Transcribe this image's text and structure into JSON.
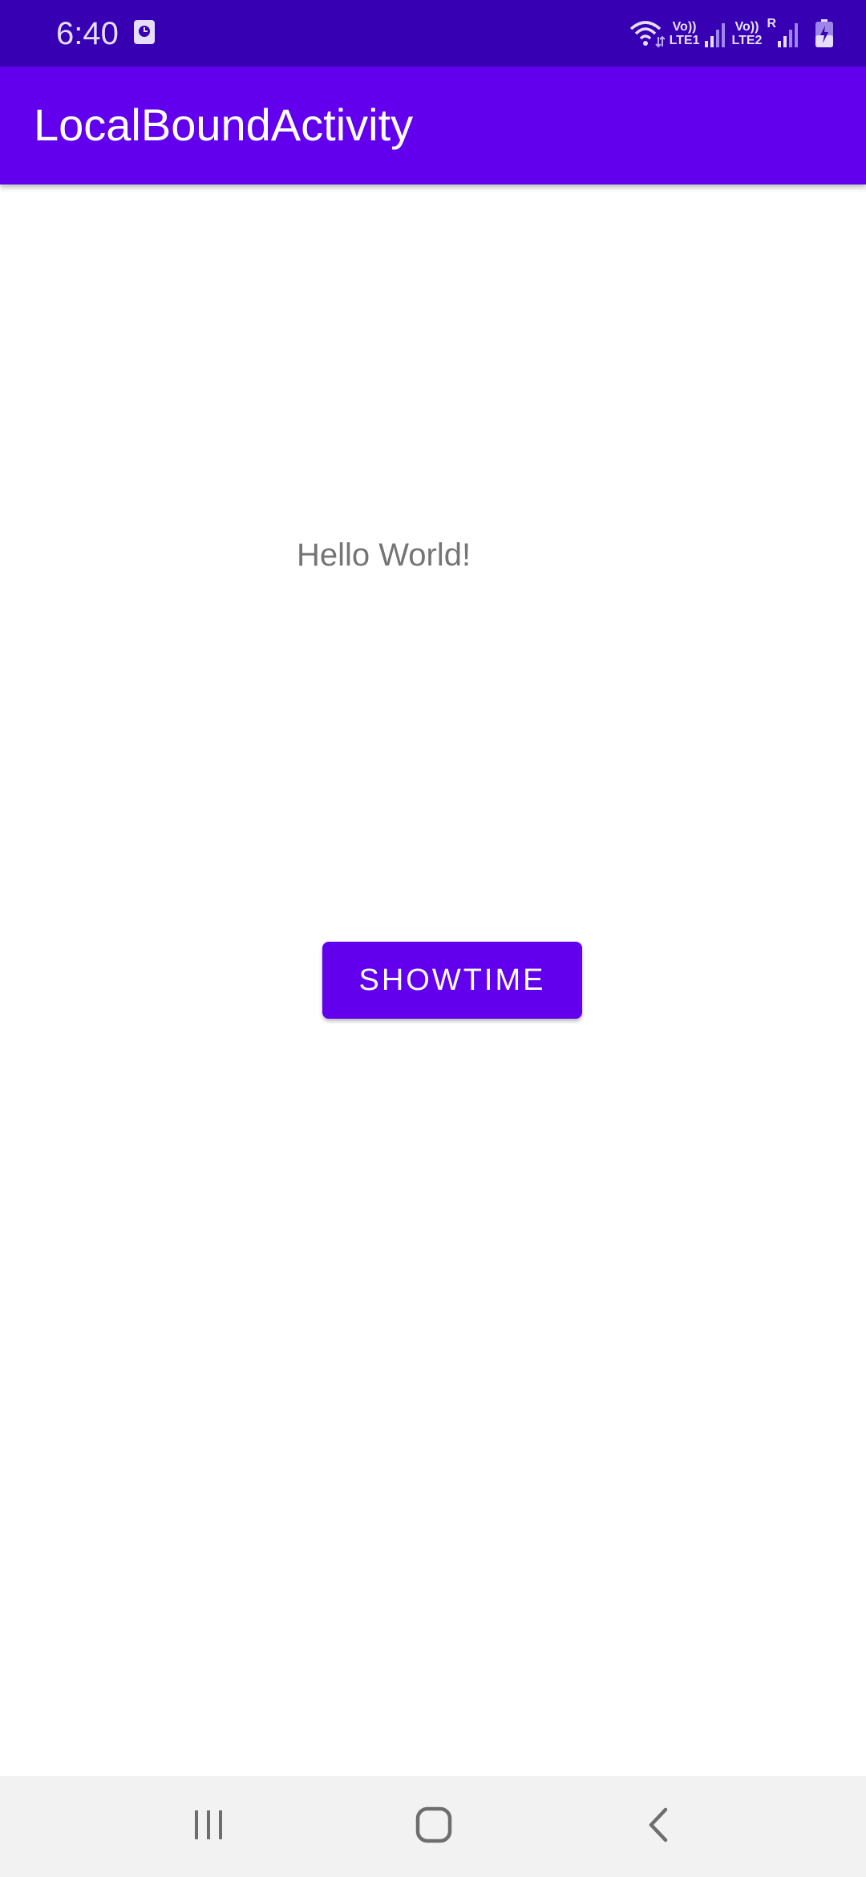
{
  "status_bar": {
    "time": "6:40",
    "sim1_top": "Vo))",
    "sim1_bottom": "LTE1",
    "sim2_top": "Vo))",
    "sim2_bottom": "LTE2",
    "roaming": "R",
    "icons": [
      "notification-icon",
      "wifi-icon",
      "signal-icon",
      "signal-icon",
      "battery-charging-icon"
    ],
    "background_color": "#3700B3"
  },
  "app_bar": {
    "title": "LocalBoundActivity",
    "background_color": "#6200EE"
  },
  "content": {
    "hello_text": "Hello World!",
    "button_label": "SHOWTIME",
    "button_color": "#6200EE"
  },
  "nav_bar": {
    "icons": [
      "recents-icon",
      "home-icon",
      "back-icon"
    ]
  }
}
